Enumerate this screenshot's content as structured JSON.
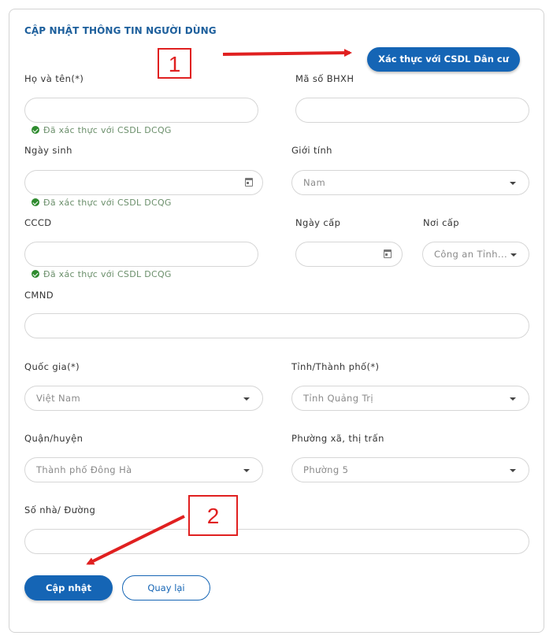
{
  "form": {
    "title": "CẬP NHẬT THÔNG TIN NGƯỜI DÙNG",
    "verify_button": "Xác thực với CSDL Dân cư",
    "verified_text": "Đã xác thực với CSDL DCQG",
    "fields": {
      "full_name": {
        "label": "Họ và tên(*)",
        "value": ""
      },
      "bhxh": {
        "label": "Mã số BHXH",
        "value": ""
      },
      "dob": {
        "label": "Ngày sinh",
        "value": ""
      },
      "gender": {
        "label": "Giới tính",
        "value": "Nam"
      },
      "cccd": {
        "label": "CCCD",
        "value": ""
      },
      "issue_date": {
        "label": "Ngày cấp",
        "value": ""
      },
      "issue_place": {
        "label": "Nơi cấp",
        "value": "Công an Tỉnh..."
      },
      "cmnd": {
        "label": "CMND",
        "value": ""
      },
      "country": {
        "label": "Quốc gia(*)",
        "value": "Việt Nam"
      },
      "province": {
        "label": "Tỉnh/Thành phố(*)",
        "value": "Tỉnh Quảng Trị"
      },
      "district": {
        "label": "Quận/huyện",
        "value": "Thành phố Đông Hà"
      },
      "ward": {
        "label": "Phường xã, thị trấn",
        "value": "Phường 5"
      },
      "address": {
        "label": "Số nhà/ Đường",
        "value": ""
      }
    },
    "buttons": {
      "update": "Cập nhật",
      "back": "Quay lại"
    }
  },
  "annotations": {
    "marker_1": "1",
    "marker_2": "2",
    "color": "#e02020"
  },
  "colors": {
    "primary": "#1565b5",
    "title": "#1d5f9c",
    "verified": "#2e8b2e"
  }
}
